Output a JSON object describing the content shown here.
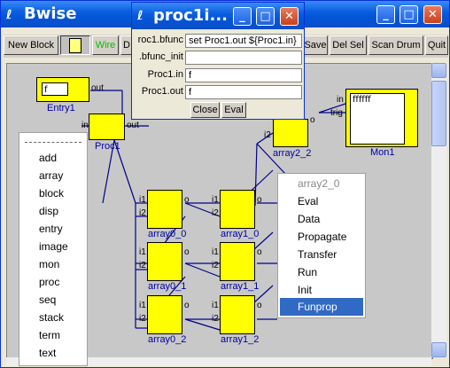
{
  "window": {
    "title": "Bwise",
    "title_icon": "feather-icon",
    "controls": {
      "minimize": "_",
      "maximize": "□",
      "close": "✕"
    }
  },
  "toolbar": {
    "new_block": "New Block",
    "file_icon": "document-icon",
    "wire": "Wire",
    "d_partial": "D",
    "save": "Save",
    "del_sel": "Del Sel",
    "scan_drum": "Scan Drum",
    "quit": "Quit"
  },
  "canvas": {
    "entry": {
      "label": "Entry1",
      "value": "f",
      "out_port": "out"
    },
    "proc": {
      "label": "Proc1",
      "in_port": "in",
      "out_port": "out"
    },
    "array2_2": {
      "label": "array2_2",
      "i2_port": "i2",
      "o_port": "o"
    },
    "mon": {
      "label": "Mon1",
      "in_port": "in",
      "trig_port": "trig",
      "value": "ffffff"
    },
    "arrays": [
      {
        "label": "array0_0",
        "i1": "i1",
        "i2": "i2",
        "o": "o"
      },
      {
        "label": "array1_0",
        "i1": "i1",
        "i2": "i2",
        "o": "o"
      },
      {
        "label": "array0_1",
        "i1": "i1",
        "i2": "i2",
        "o": "o"
      },
      {
        "label": "array1_1",
        "i1": "i1",
        "i2": "i2",
        "o": "o"
      },
      {
        "label": "array0_2",
        "i1": "i1",
        "i2": "i2",
        "o": "o"
      },
      {
        "label": "array1_2",
        "i1": "i1",
        "i2": "i2",
        "o": "o"
      }
    ]
  },
  "block_menu": {
    "items": [
      "add",
      "array",
      "block",
      "disp",
      "entry",
      "image",
      "mon",
      "proc",
      "seq",
      "stack",
      "term",
      "text"
    ]
  },
  "context_menu": {
    "title": "array2_0",
    "items": [
      "Eval",
      "Data",
      "Propagate",
      "Transfer",
      "Run",
      "Init",
      "Funprop"
    ],
    "selected": "Funprop"
  },
  "proc_dialog": {
    "title": "proc1i...",
    "rows": [
      {
        "label": "roc1.bfunc",
        "value": "set Proc1.out ${Proc1.in}"
      },
      {
        "label": ".bfunc_init",
        "value": ""
      },
      {
        "label": "Proc1.in",
        "value": "f"
      },
      {
        "label": "Proc1.out",
        "value": "f"
      }
    ],
    "buttons": {
      "close": "Close",
      "eval": "Eval"
    }
  },
  "colors": {
    "block": "#ffff00",
    "label": "#0000a0",
    "wire": "#00008b",
    "selection": "#316ac5"
  }
}
